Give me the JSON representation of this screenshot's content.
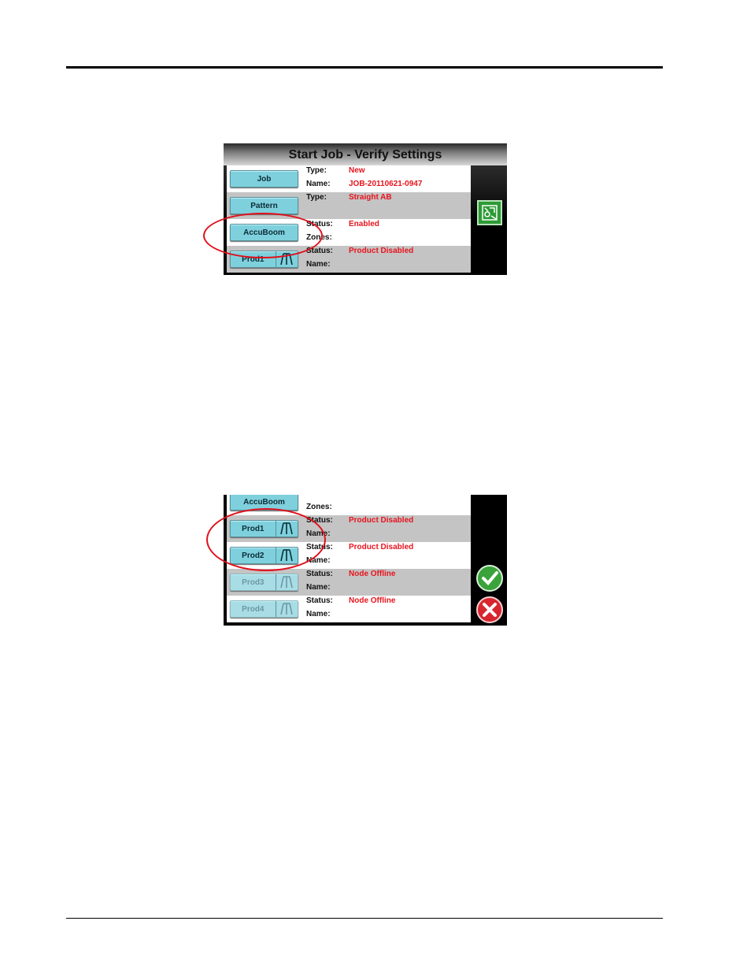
{
  "screen_one": {
    "title": "Start Job - Verify Settings",
    "rows": [
      {
        "button": "Job",
        "label1": "Type:",
        "value1": "New",
        "label2": "Name:",
        "value2": "JOB-20110621-0947"
      },
      {
        "button": "Pattern",
        "label1": "Type:",
        "value1": "Straight AB",
        "label2": "",
        "value2": ""
      },
      {
        "button": "AccuBoom",
        "label1": "Status:",
        "value1": "Enabled",
        "label2": "Zones:",
        "value2": ""
      },
      {
        "button": "Prod1",
        "label1": "Status:",
        "value1": "Product Disabled",
        "label2": "Name:",
        "value2": ""
      }
    ],
    "side_icon": "gps-guidance-icon"
  },
  "screen_two": {
    "rows": [
      {
        "button": "AccuBoom",
        "label1": "",
        "value1": "",
        "label2": "Zones:",
        "value2": ""
      },
      {
        "button": "Prod1",
        "label1": "Status:",
        "value1": "Product Disabled",
        "label2": "Name:",
        "value2": ""
      },
      {
        "button": "Prod2",
        "label1": "Status:",
        "value1": "Product Disabled",
        "label2": "Name:",
        "value2": ""
      },
      {
        "button": "Prod3",
        "label1": "Status:",
        "value1": "Node Offline",
        "label2": "Name:",
        "value2": ""
      },
      {
        "button": "Prod4",
        "label1": "Status:",
        "value1": "Node Offline",
        "label2": "Name:",
        "value2": ""
      }
    ],
    "accept_icon": "checkmark-icon",
    "cancel_icon": "x-cancel-icon"
  },
  "colors": {
    "button": "#7fd0dd",
    "value_text": "#e8141e",
    "highlight": "#e0101c",
    "row_alt": "#c4c4c4"
  }
}
